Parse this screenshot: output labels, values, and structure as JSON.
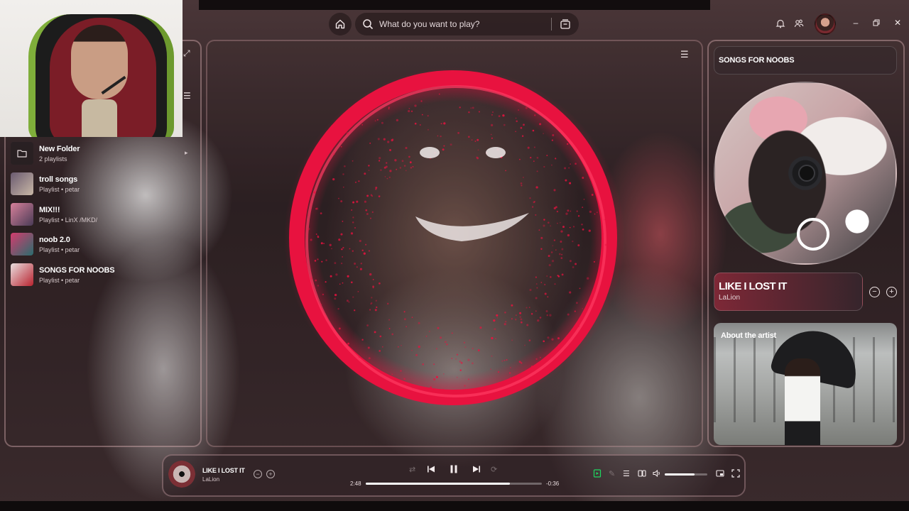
{
  "search": {
    "placeholder": "What do you want to play?"
  },
  "library": {
    "items": [
      {
        "title": "New Folder",
        "subtitle": "2 playlists",
        "type": "folder"
      },
      {
        "title": "troll songs",
        "subtitle": "Playlist • petar",
        "type": "playlist",
        "colors": [
          "#6a5a70",
          "#c9b8a6"
        ]
      },
      {
        "title": "MIX!!!",
        "subtitle": "Playlist • LinX /MKD/",
        "type": "playlist",
        "colors": [
          "#d7809a",
          "#4a3b56"
        ]
      },
      {
        "title": "noob 2.0",
        "subtitle": "Playlist • petar",
        "type": "playlist",
        "colors": [
          "#d43c6e",
          "#2a6d6e"
        ]
      },
      {
        "title": "SONGS FOR NOOBS",
        "subtitle": "Playlist • petar",
        "type": "playlist",
        "colors": [
          "#e9dfe0",
          "#b8232f"
        ]
      }
    ]
  },
  "right_panel": {
    "header": "SONGS FOR NOOBS",
    "now_playing": {
      "title": "LIKE I LOST IT",
      "artist": "LaLion"
    },
    "about": {
      "label": "About the artist"
    }
  },
  "player": {
    "title": "LIKE I LOST IT",
    "artist": "LaLion",
    "elapsed": "2:48",
    "remaining": "-0:36",
    "progress": 0.82,
    "volume": 0.7
  },
  "colors": {
    "accent": "#e8123f",
    "spotify_green": "#1ed760"
  },
  "icons": [
    "home-icon",
    "search-icon",
    "browse-icon",
    "bell-icon",
    "friends-icon",
    "minimize-icon",
    "maximize-icon",
    "close-icon",
    "folder-icon",
    "menu-icon",
    "shuffle-icon",
    "previous-icon",
    "pause-icon",
    "next-icon",
    "repeat-icon",
    "now-playing-view-icon",
    "lyrics-icon",
    "queue-icon",
    "connect-device-icon",
    "volume-icon",
    "miniplayer-icon",
    "fullscreen-icon"
  ]
}
